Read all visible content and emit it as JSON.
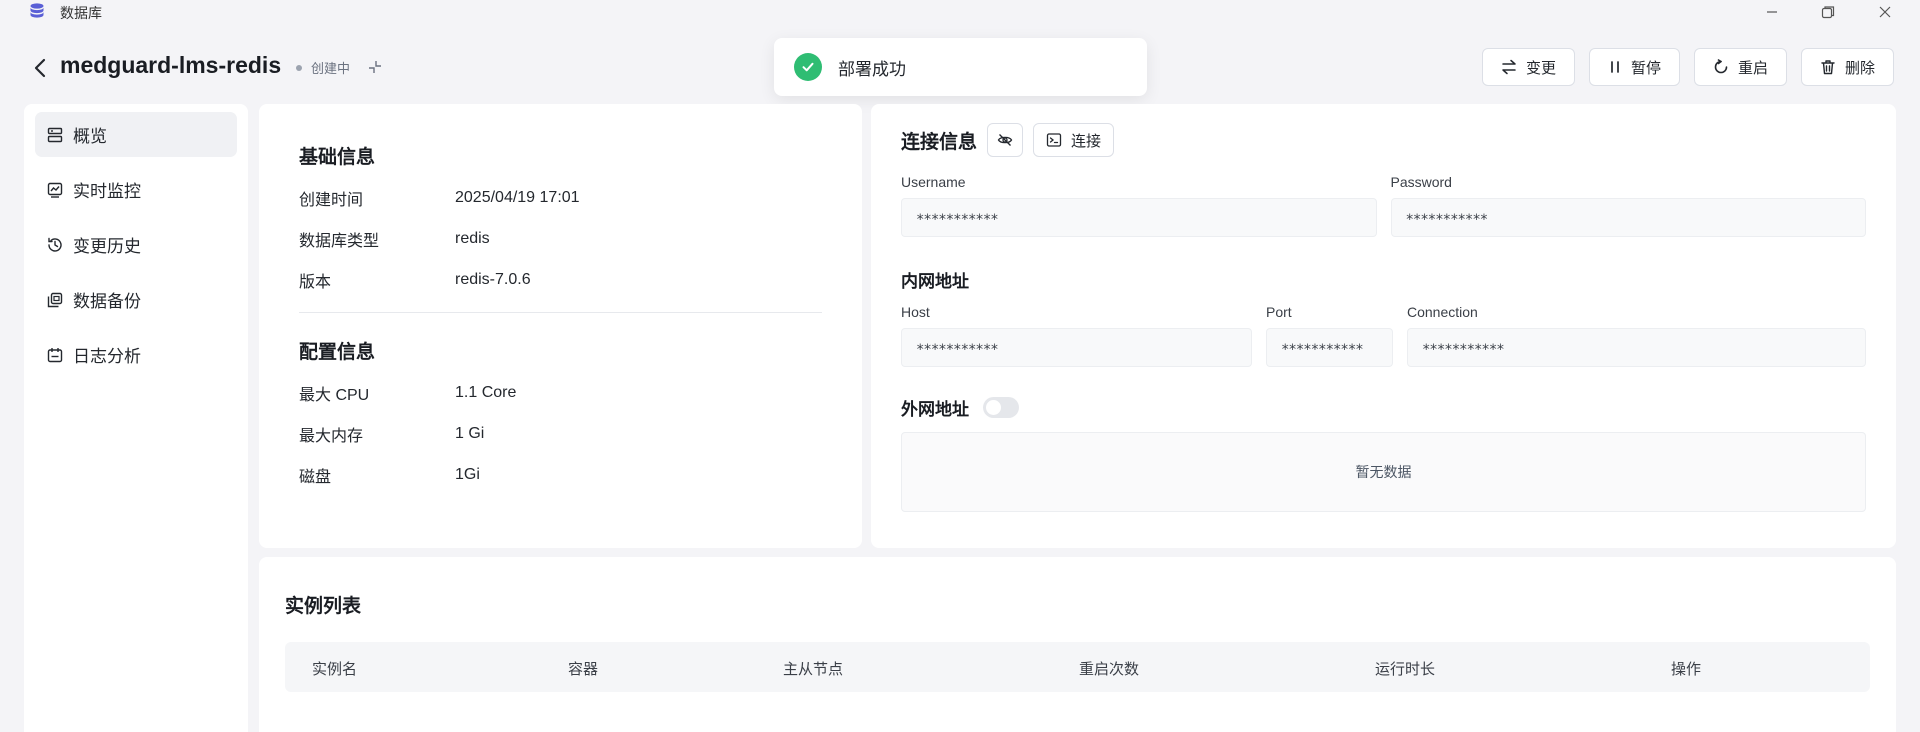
{
  "window": {
    "app_name": "数据库"
  },
  "header": {
    "title": "medguard-lms-redis",
    "status": "创建中"
  },
  "toast": {
    "message": "部署成功"
  },
  "actions": {
    "change": "变更",
    "pause": "暂停",
    "restart": "重启",
    "delete": "删除"
  },
  "sidebar": {
    "items": [
      {
        "label": "概览",
        "icon": "overview-icon"
      },
      {
        "label": "实时监控",
        "icon": "monitor-icon"
      },
      {
        "label": "变更历史",
        "icon": "history-icon"
      },
      {
        "label": "数据备份",
        "icon": "backup-icon"
      },
      {
        "label": "日志分析",
        "icon": "log-icon"
      }
    ]
  },
  "basic_info": {
    "title": "基础信息",
    "rows": [
      {
        "key": "创建时间",
        "value": "2025/04/19 17:01"
      },
      {
        "key": "数据库类型",
        "value": "redis"
      },
      {
        "key": "版本",
        "value": "redis-7.0.6"
      }
    ]
  },
  "config_info": {
    "title": "配置信息",
    "rows": [
      {
        "key": "最大 CPU",
        "value": "1.1 Core"
      },
      {
        "key": "最大内存",
        "value": "1 Gi"
      },
      {
        "key": "磁盘",
        "value": "1Gi"
      }
    ]
  },
  "connection": {
    "title": "连接信息",
    "connect_label": "连接",
    "username": {
      "label": "Username",
      "value": "***********"
    },
    "password": {
      "label": "Password",
      "value": "***********"
    },
    "internal": {
      "title": "内网地址",
      "host": {
        "label": "Host",
        "value": "***********"
      },
      "port": {
        "label": "Port",
        "value": "***********"
      },
      "connection": {
        "label": "Connection",
        "value": "***********"
      }
    },
    "external": {
      "title": "外网地址",
      "enabled": false,
      "empty_text": "暂无数据"
    }
  },
  "instances": {
    "title": "实例列表",
    "columns": [
      "实例名",
      "容器",
      "主从节点",
      "重启次数",
      "运行时长",
      "操作"
    ]
  },
  "colors": {
    "accent": "#5a5fd6",
    "success": "#2fbd73",
    "background": "#f4f4f7"
  }
}
